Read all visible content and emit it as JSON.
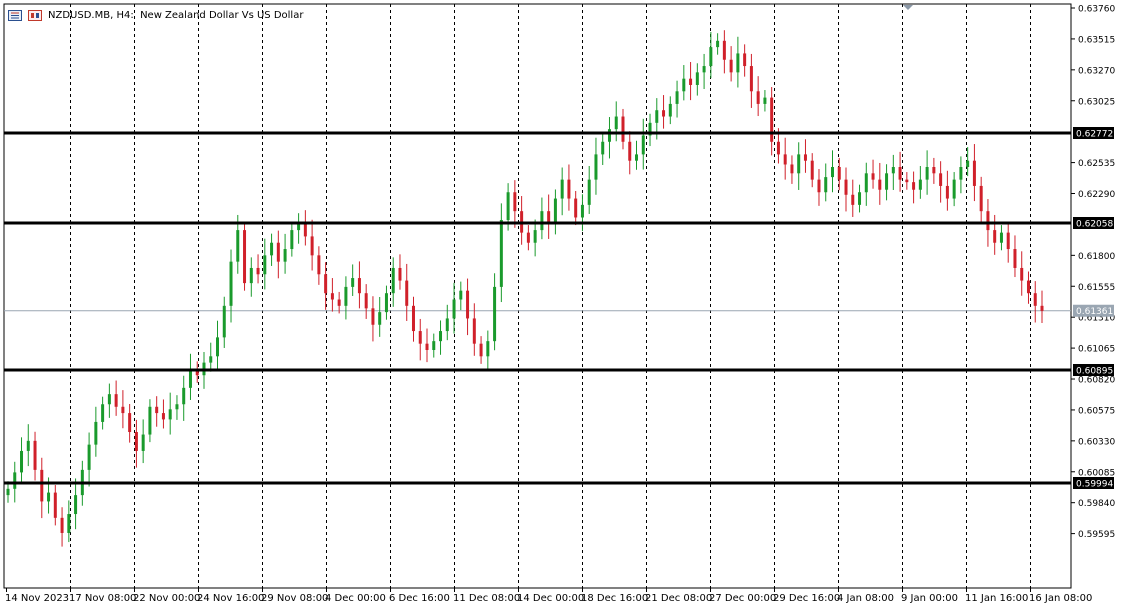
{
  "window": {
    "symbol": "NZDUSD.MB",
    "timeframe": "H4:",
    "description": "New Zealand Dollar Vs US Dollar",
    "icons": [
      "chart-type-icon",
      "one-click-trading-icon"
    ]
  },
  "colors": {
    "bull": "#1a9a2c",
    "bear": "#d0202a",
    "grid": "#000000",
    "hline": "#000000",
    "bidline": "#9aa6b2",
    "axis_text": "#000000"
  },
  "chart_data": {
    "type": "candlestick",
    "title": "NZDUSD.MB, H4:  New Zealand Dollar Vs US Dollar",
    "y_axis_ticks": [
      0.6376,
      0.63515,
      0.6327,
      0.63025,
      0.62535,
      0.6229,
      0.618,
      0.61555,
      0.6131,
      0.61065,
      0.6082,
      0.60575,
      0.6033,
      0.60085,
      0.5984,
      0.59595
    ],
    "ylim": [
      0.5937,
      0.6376
    ],
    "x_axis_ticks": [
      "14 Nov 2023",
      "17 Nov 08:00",
      "22 Nov 00:00",
      "24 Nov 16:00",
      "29 Nov 08:00",
      "4 Dec 00:00",
      "6 Dec 16:00",
      "11 Dec 08:00",
      "14 Dec 00:00",
      "18 Dec 16:00",
      "21 Dec 08:00",
      "27 Dec 00:00",
      "29 Dec 16:00",
      "4 Jan 08:00",
      "9 Jan 00:00",
      "11 Jan 16:00",
      "16 Jan 08:00"
    ],
    "horizontal_levels": [
      {
        "value": 0.62772,
        "label": "0.62772"
      },
      {
        "value": 0.62058,
        "label": "0.62058"
      },
      {
        "value": 0.60895,
        "label": "0.60895"
      },
      {
        "value": 0.59994,
        "label": "0.59994"
      }
    ],
    "bid_line": {
      "value": 0.61361,
      "label": "0.61361"
    },
    "grid_vertical": true,
    "candles_close": [
      0.5995,
      0.6008,
      0.6025,
      0.6033,
      0.601,
      0.5985,
      0.5992,
      0.5972,
      0.596,
      0.5975,
      0.599,
      0.601,
      0.603,
      0.6048,
      0.6062,
      0.607,
      0.606,
      0.6055,
      0.604,
      0.6025,
      0.6038,
      0.606,
      0.6055,
      0.605,
      0.6058,
      0.6062,
      0.6075,
      0.609,
      0.6085,
      0.6095,
      0.61,
      0.6115,
      0.614,
      0.6175,
      0.62,
      0.6158,
      0.617,
      0.6165,
      0.618,
      0.619,
      0.6175,
      0.6185,
      0.62,
      0.6205,
      0.6195,
      0.618,
      0.6165,
      0.615,
      0.6145,
      0.614,
      0.6155,
      0.6162,
      0.615,
      0.6138,
      0.6125,
      0.6135,
      0.615,
      0.617,
      0.616,
      0.614,
      0.612,
      0.611,
      0.6105,
      0.6112,
      0.612,
      0.613,
      0.6145,
      0.6152,
      0.613,
      0.611,
      0.61,
      0.6112,
      0.6155,
      0.6208,
      0.623,
      0.6215,
      0.6198,
      0.619,
      0.62,
      0.6215,
      0.6205,
      0.6225,
      0.624,
      0.6225,
      0.621,
      0.622,
      0.624,
      0.626,
      0.627,
      0.628,
      0.629,
      0.627,
      0.6255,
      0.626,
      0.6275,
      0.6285,
      0.6295,
      0.629,
      0.63,
      0.631,
      0.632,
      0.6315,
      0.6325,
      0.633,
      0.6345,
      0.635,
      0.6335,
      0.6325,
      0.634,
      0.633,
      0.631,
      0.63,
      0.6305,
      0.627,
      0.626,
      0.6252,
      0.6245,
      0.626,
      0.6255,
      0.624,
      0.623,
      0.6242,
      0.625,
      0.624,
      0.6228,
      0.622,
      0.623,
      0.6245,
      0.624,
      0.6232,
      0.6245,
      0.625,
      0.624,
      0.6238,
      0.6232,
      0.624,
      0.625,
      0.6245,
      0.6235,
      0.6225,
      0.624,
      0.625,
      0.6255,
      0.6235,
      0.6215,
      0.62,
      0.619,
      0.6198,
      0.6185,
      0.617,
      0.616,
      0.615,
      0.614,
      0.6136
    ]
  }
}
